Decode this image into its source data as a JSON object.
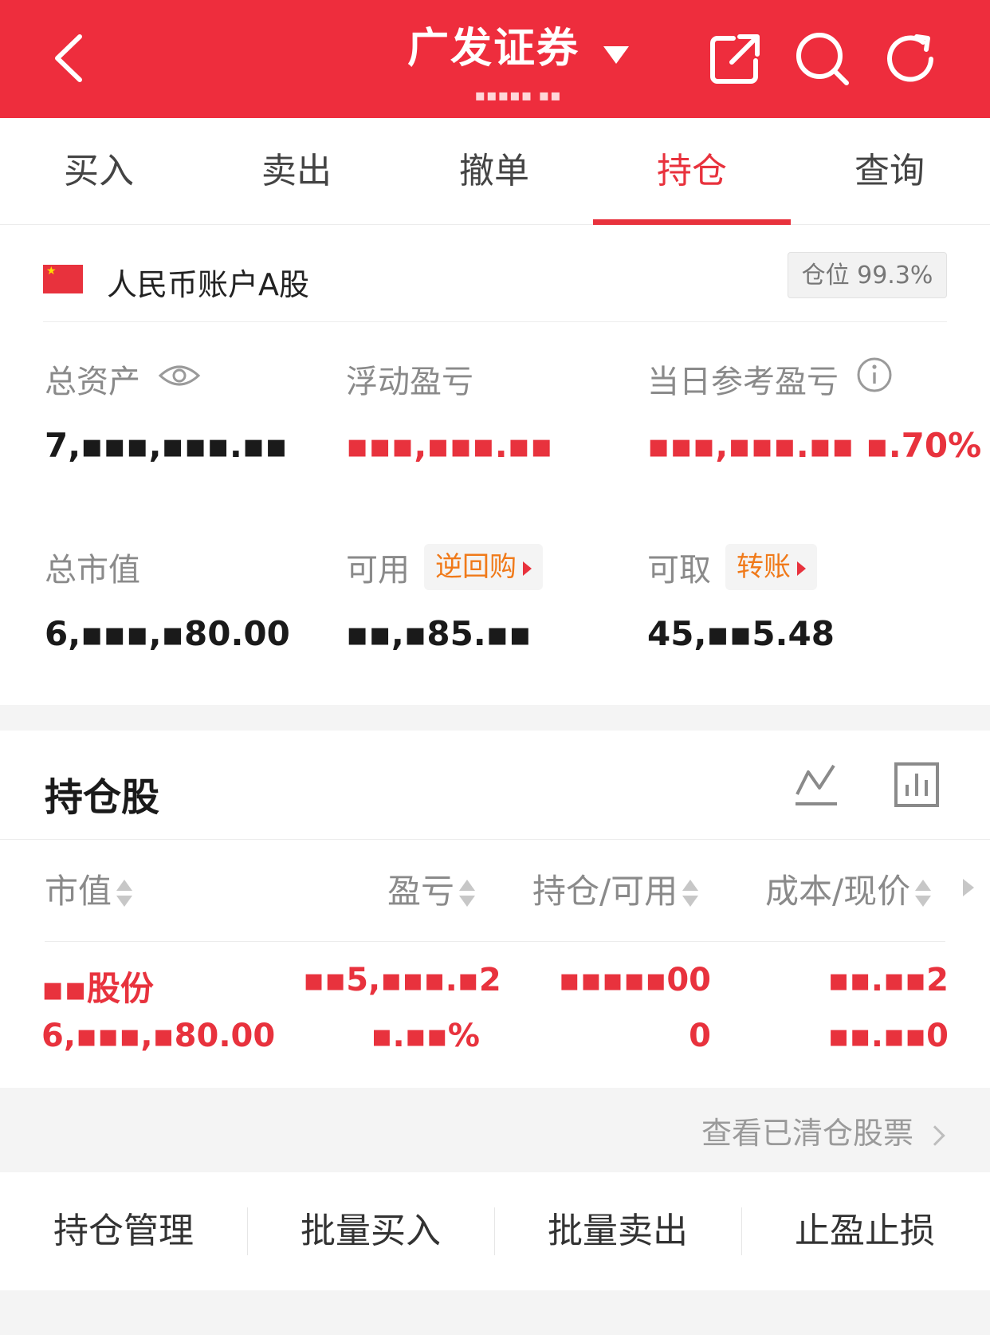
{
  "header": {
    "title": "广发证券",
    "subtitle": "▪▪▪▪▪ ▪▪"
  },
  "tabs": [
    {
      "label": "买入"
    },
    {
      "label": "卖出"
    },
    {
      "label": "撤单"
    },
    {
      "label": "持仓",
      "active": true
    },
    {
      "label": "查询"
    }
  ],
  "account": {
    "name": "人民币账户A股",
    "position_badge": "仓位 99.3%"
  },
  "stats": {
    "total_assets": {
      "label": "总资产",
      "value": "7,▪▪▪,▪▪▪.▪▪"
    },
    "floating_pl": {
      "label": "浮动盈亏",
      "value": "▪▪▪,▪▪▪.▪▪"
    },
    "daily_pl": {
      "label": "当日参考盈亏",
      "value": "▪▪▪,▪▪▪.▪▪ ▪.70%"
    },
    "market_value": {
      "label": "总市值",
      "value": "6,▪▪▪,▪80.00"
    },
    "available": {
      "label": "可用",
      "value": "▪▪,▪85.▪▪",
      "button": "逆回购"
    },
    "withdrawable": {
      "label": "可取",
      "value": "45,▪▪5.48",
      "button": "转账"
    }
  },
  "holdings": {
    "title": "持仓股",
    "columns": [
      "市值",
      "盈亏",
      "持仓/可用",
      "成本/现价"
    ],
    "rows": [
      {
        "name": "▪▪股份",
        "market_value": "6,▪▪▪,▪80.00",
        "pl": "▪▪5,▪▪▪.▪2",
        "pl_pct": "▪.▪▪%",
        "position": "▪▪▪▪▪00",
        "available": "0",
        "cost": "▪▪.▪▪2",
        "price": "▪▪.▪▪0"
      }
    ]
  },
  "cleared_link": "查看已清仓股票",
  "actions": [
    "持仓管理",
    "批量买入",
    "批量卖出",
    "止盈止损"
  ],
  "colors": {
    "brand_red": "#ee2d3d",
    "accent_orange": "#f07a1a"
  }
}
